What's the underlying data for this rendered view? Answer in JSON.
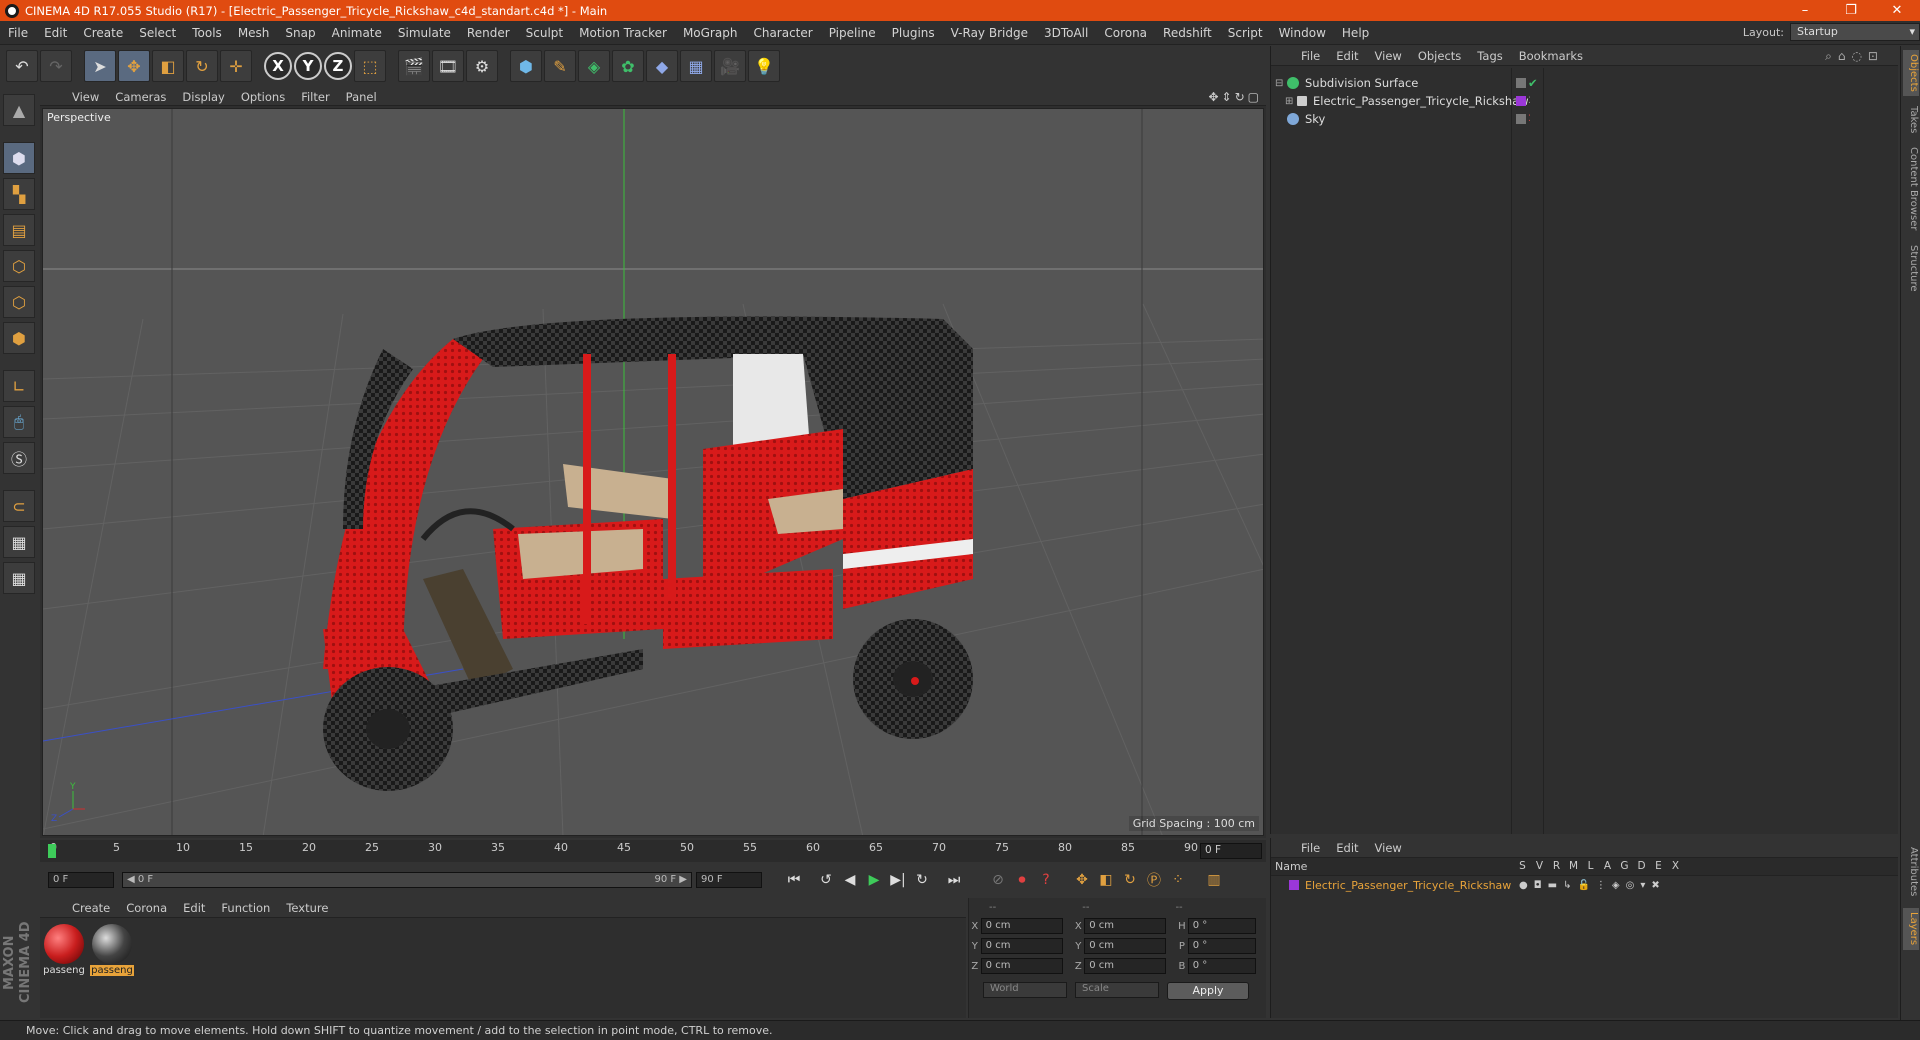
{
  "app": {
    "title": "CINEMA 4D R17.055 Studio (R17) - [Electric_Passenger_Tricycle_Rickshaw_c4d_standart.c4d *] - Main",
    "window_controls": [
      "–",
      "❐",
      "✕"
    ]
  },
  "menubar": {
    "items": [
      "File",
      "Edit",
      "Create",
      "Select",
      "Tools",
      "Mesh",
      "Snap",
      "Animate",
      "Simulate",
      "Render",
      "Sculpt",
      "Motion Tracker",
      "MoGraph",
      "Character",
      "Pipeline",
      "Plugins",
      "V-Ray Bridge",
      "3DToAll",
      "Corona",
      "Redshift",
      "Script",
      "Window",
      "Help"
    ],
    "layout_label": "Layout:",
    "layout_value": "Startup"
  },
  "toolbar": {
    "icons": [
      "undo-icon",
      "redo-icon",
      "select-arrow-icon",
      "move-icon",
      "scale-icon",
      "rotate-icon",
      "live-select-icon",
      "x-axis-icon",
      "y-axis-icon",
      "z-axis-icon",
      "coord-system-icon",
      "render-view-icon",
      "render-picture-viewer-icon",
      "render-settings-icon",
      "cube-icon",
      "pen-spline-icon",
      "subdivision-icon",
      "cloner-icon",
      "deformer-icon",
      "floor-icon",
      "camera-icon",
      "light-icon"
    ],
    "axis": {
      "x": "X",
      "y": "Y",
      "z": "Z"
    }
  },
  "viewport": {
    "menu": [
      "View",
      "Cameras",
      "Display",
      "Options",
      "Filter",
      "Panel"
    ],
    "label": "Perspective",
    "grid_spacing": "Grid Spacing : 100 cm",
    "axis_y": "Y",
    "axis_z": "Z"
  },
  "timeline": {
    "ticks": [
      "0",
      "5",
      "10",
      "15",
      "20",
      "25",
      "30",
      "35",
      "40",
      "45",
      "50",
      "55",
      "60",
      "65",
      "70",
      "75",
      "80",
      "85",
      "90"
    ],
    "current_frame": "0 F"
  },
  "transport": {
    "start_field": "0 F",
    "range_start": "◀ 0 F",
    "range_end": "90 F ▶",
    "end_field": "90 F"
  },
  "materials": {
    "menu": [
      "Create",
      "Corona",
      "Edit",
      "Function",
      "Texture"
    ],
    "items": [
      {
        "label": "passeng",
        "color": "#c91e1e"
      },
      {
        "label": "passeng",
        "color": "#2a2a2a"
      }
    ]
  },
  "coordinates": {
    "headers": [
      "--",
      "--",
      "--"
    ],
    "rows": [
      {
        "a": "X",
        "av": "0 cm",
        "b": "X",
        "bv": "0 cm",
        "c": "H",
        "cv": "0 °"
      },
      {
        "a": "Y",
        "av": "0 cm",
        "b": "Y",
        "bv": "0 cm",
        "c": "P",
        "cv": "0 °"
      },
      {
        "a": "Z",
        "av": "0 cm",
        "b": "Z",
        "bv": "0 cm",
        "c": "B",
        "cv": "0 °"
      }
    ],
    "world": "World",
    "scale": "Scale",
    "apply": "Apply"
  },
  "object_manager": {
    "menu": [
      "File",
      "Edit",
      "View",
      "Objects",
      "Tags",
      "Bookmarks"
    ],
    "objects": [
      {
        "name": "Subdivision Surface",
        "color": "#3fbf6a"
      },
      {
        "name": "Electric_Passenger_Tricycle_Rickshaw",
        "color": "#cccccc"
      },
      {
        "name": "Sky",
        "color": "#7fa8d8"
      }
    ]
  },
  "layer_manager": {
    "menu": [
      "File",
      "Edit",
      "View"
    ],
    "name_header": "Name",
    "columns": [
      "S",
      "V",
      "R",
      "M",
      "L",
      "A",
      "G",
      "D",
      "E",
      "X"
    ],
    "layer": "Electric_Passenger_Tricycle_Rickshaw",
    "layer_color": "#9b37d8"
  },
  "right_tabs": [
    "Objects",
    "Takes",
    "Content Browser",
    "Structure",
    "Attributes",
    "Layers"
  ],
  "branding": "MAXON CINEMA 4D",
  "status": "Move: Click and drag to move elements. Hold down SHIFT to quantize movement / add to the selection in point mode, CTRL to remove."
}
